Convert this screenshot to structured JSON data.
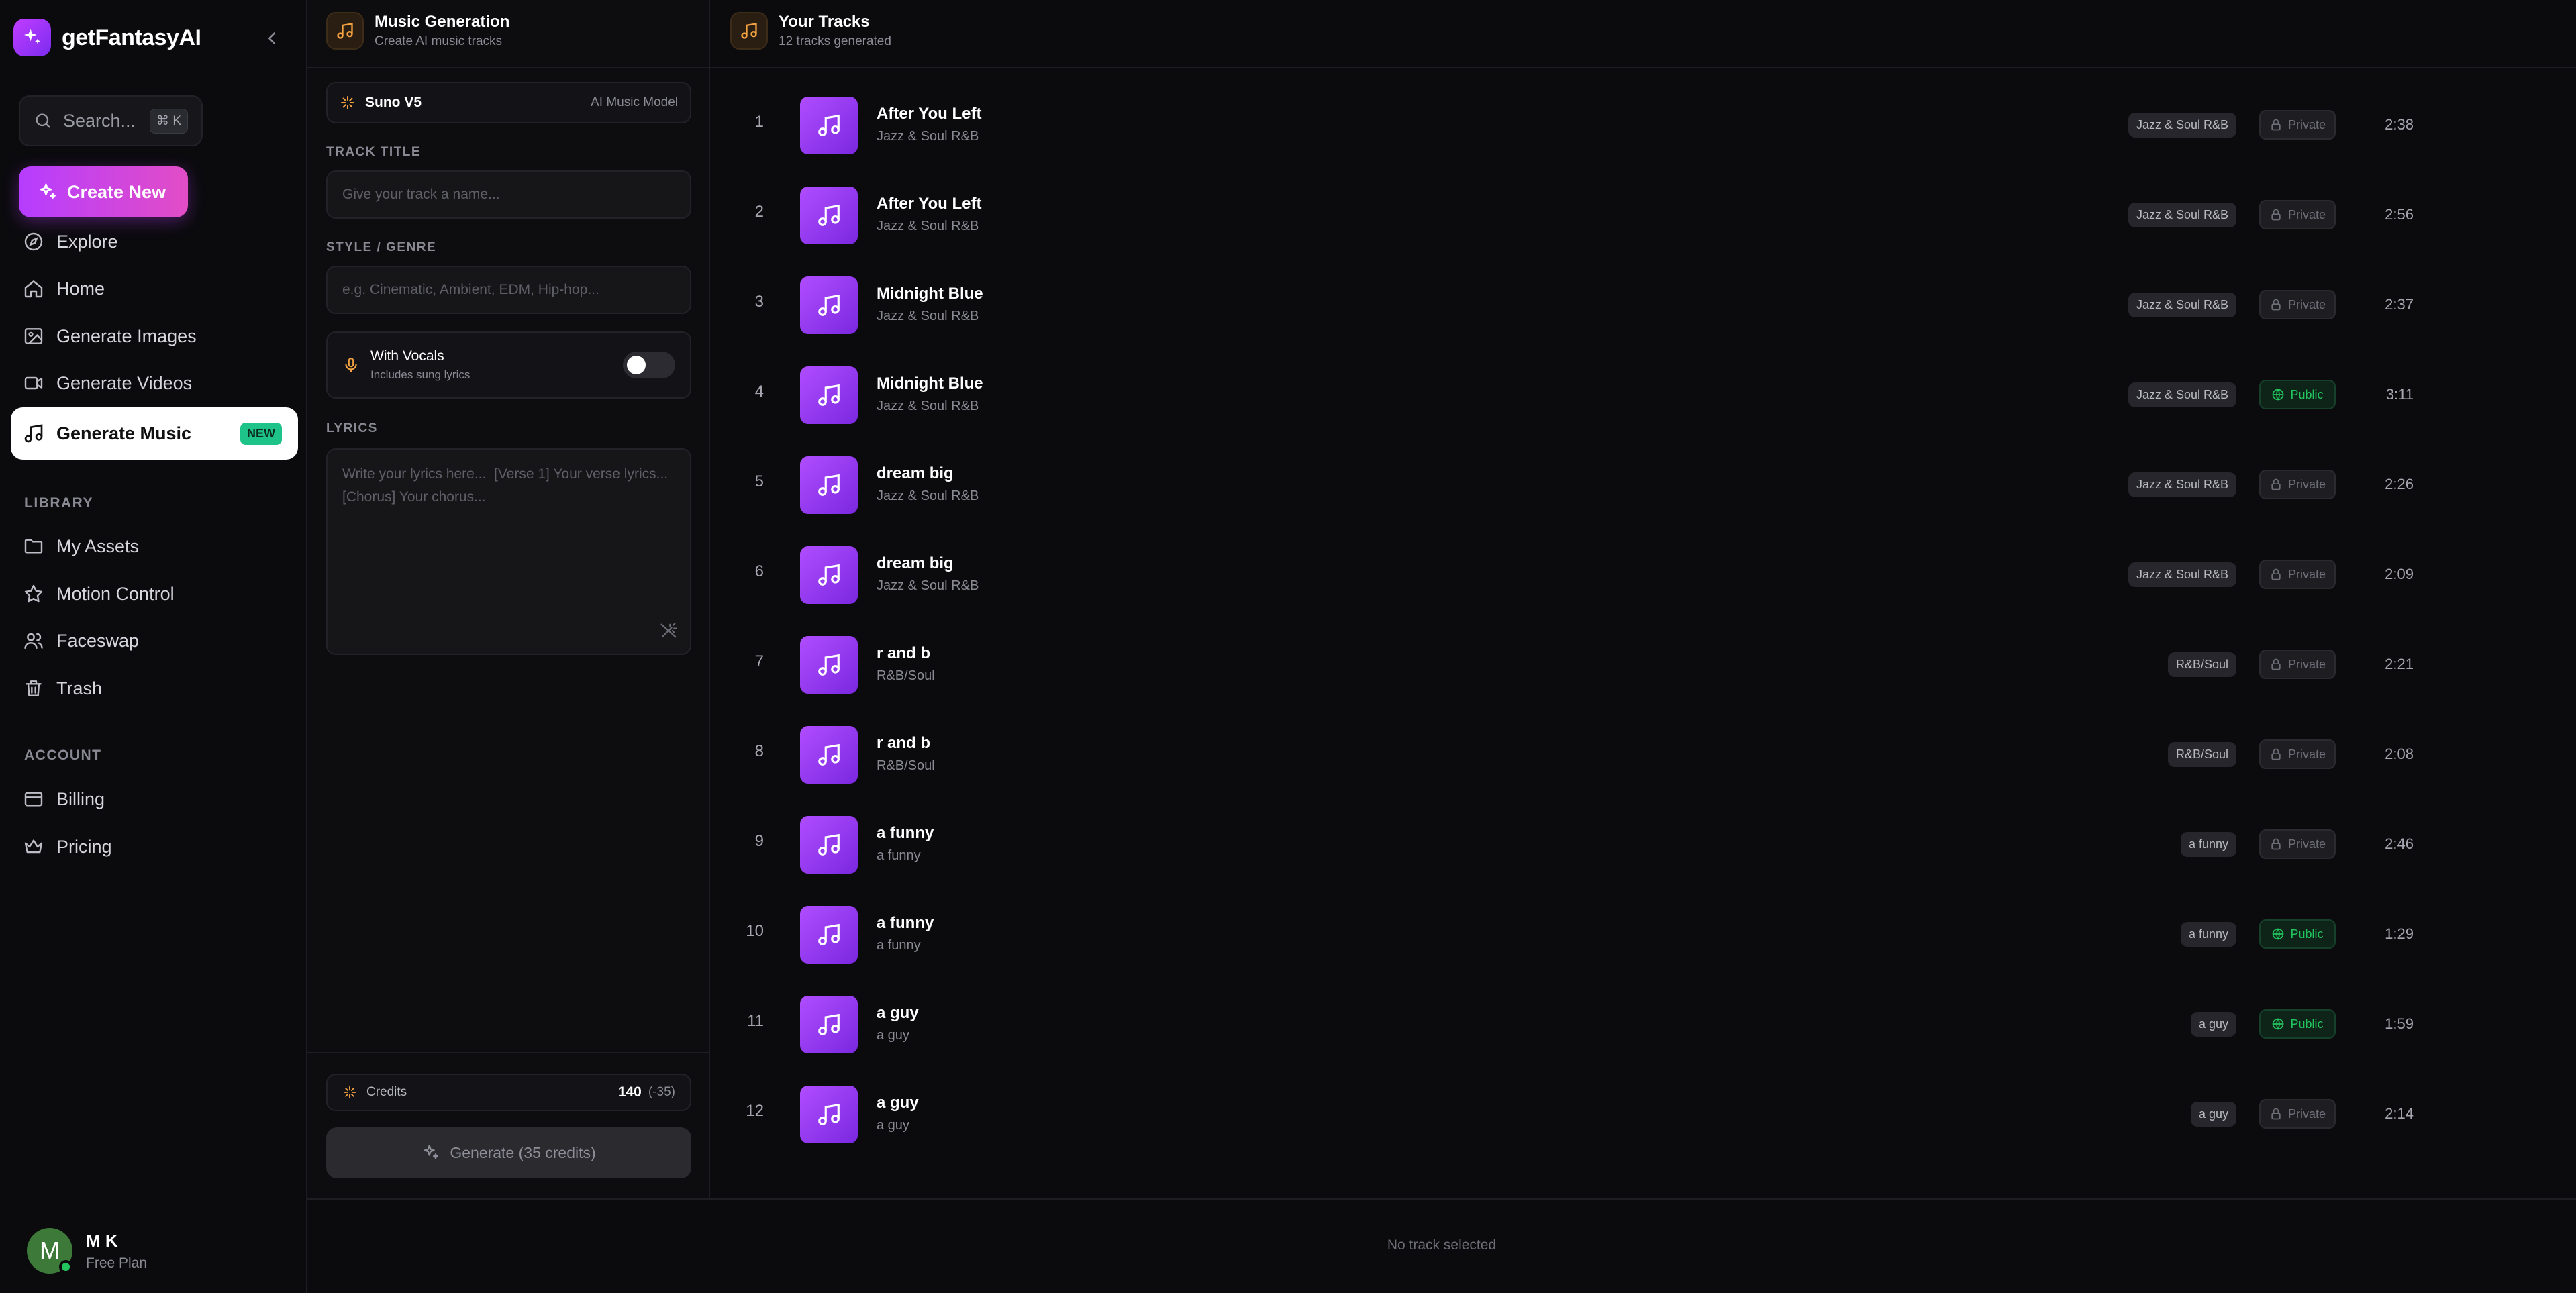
{
  "app": {
    "name": "getFantasyAI"
  },
  "search": {
    "placeholder": "Search...",
    "shortcut": "⌘ K"
  },
  "create_button": {
    "label": "Create New"
  },
  "nav": [
    {
      "label": "Explore",
      "icon": "compass-icon"
    },
    {
      "label": "Home",
      "icon": "home-icon"
    },
    {
      "label": "Generate Images",
      "icon": "image-icon"
    },
    {
      "label": "Generate Videos",
      "icon": "video-icon"
    },
    {
      "label": "Generate Music",
      "icon": "music-note-icon",
      "badge": "NEW",
      "active": true
    }
  ],
  "library": {
    "label": "LIBRARY",
    "items": [
      {
        "label": "My Assets",
        "icon": "folder-icon"
      },
      {
        "label": "Motion Control",
        "icon": "star-icon"
      },
      {
        "label": "Faceswap",
        "icon": "users-icon"
      },
      {
        "label": "Trash",
        "icon": "trash-icon"
      }
    ]
  },
  "account": {
    "label": "ACCOUNT",
    "items": [
      {
        "label": "Billing",
        "icon": "credit-card-icon"
      },
      {
        "label": "Pricing",
        "icon": "crown-icon"
      }
    ]
  },
  "user": {
    "initial": "M",
    "name": "M K",
    "plan": "Free Plan"
  },
  "generator": {
    "title": "Music Generation",
    "subtitle": "Create AI music tracks",
    "model": {
      "name": "Suno V5",
      "tag": "AI Music Model"
    },
    "track_title": {
      "label": "TRACK TITLE",
      "placeholder": "Give your track a name..."
    },
    "style": {
      "label": "STYLE / GENRE",
      "placeholder": "e.g. Cinematic, Ambient, EDM, Hip-hop..."
    },
    "vocals": {
      "title": "With Vocals",
      "subtitle": "Includes sung lyrics",
      "enabled": false
    },
    "lyrics": {
      "label": "LYRICS",
      "placeholder": "Write your lyrics here...  [Verse 1] Your verse lyrics...  [Chorus] Your chorus..."
    },
    "credits": {
      "label": "Credits",
      "value": "140",
      "delta": "(-35)"
    },
    "generate_label": "Generate (35 credits)"
  },
  "tracks": {
    "title": "Your Tracks",
    "subtitle": "12 tracks generated",
    "items": [
      {
        "num": "1",
        "title": "After You Left",
        "genre": "Jazz & Soul R&B",
        "tag": "Jazz & Soul R&B",
        "visibility": "Private",
        "duration": "2:38"
      },
      {
        "num": "2",
        "title": "After You Left",
        "genre": "Jazz & Soul R&B",
        "tag": "Jazz & Soul R&B",
        "visibility": "Private",
        "duration": "2:56"
      },
      {
        "num": "3",
        "title": "Midnight Blue",
        "genre": "Jazz & Soul R&B",
        "tag": "Jazz & Soul R&B",
        "visibility": "Private",
        "duration": "2:37"
      },
      {
        "num": "4",
        "title": "Midnight Blue",
        "genre": "Jazz & Soul R&B",
        "tag": "Jazz & Soul R&B",
        "visibility": "Public",
        "duration": "3:11"
      },
      {
        "num": "5",
        "title": "dream big",
        "genre": "Jazz & Soul R&B",
        "tag": "Jazz & Soul R&B",
        "visibility": "Private",
        "duration": "2:26"
      },
      {
        "num": "6",
        "title": "dream big",
        "genre": "Jazz & Soul R&B",
        "tag": "Jazz & Soul R&B",
        "visibility": "Private",
        "duration": "2:09"
      },
      {
        "num": "7",
        "title": "r and b",
        "genre": "R&B/Soul",
        "tag": "R&B/Soul",
        "visibility": "Private",
        "duration": "2:21"
      },
      {
        "num": "8",
        "title": "r and b",
        "genre": "R&B/Soul",
        "tag": "R&B/Soul",
        "visibility": "Private",
        "duration": "2:08"
      },
      {
        "num": "9",
        "title": "a funny",
        "genre": "a funny",
        "tag": "a funny",
        "visibility": "Private",
        "duration": "2:46"
      },
      {
        "num": "10",
        "title": "a funny",
        "genre": "a funny",
        "tag": "a funny",
        "visibility": "Public",
        "duration": "1:29"
      },
      {
        "num": "11",
        "title": "a guy",
        "genre": "a guy",
        "tag": "a guy",
        "visibility": "Public",
        "duration": "1:59"
      },
      {
        "num": "12",
        "title": "a guy",
        "genre": "a guy",
        "tag": "a guy",
        "visibility": "Private",
        "duration": "2:14"
      }
    ]
  },
  "player": {
    "empty_text": "No track selected"
  }
}
